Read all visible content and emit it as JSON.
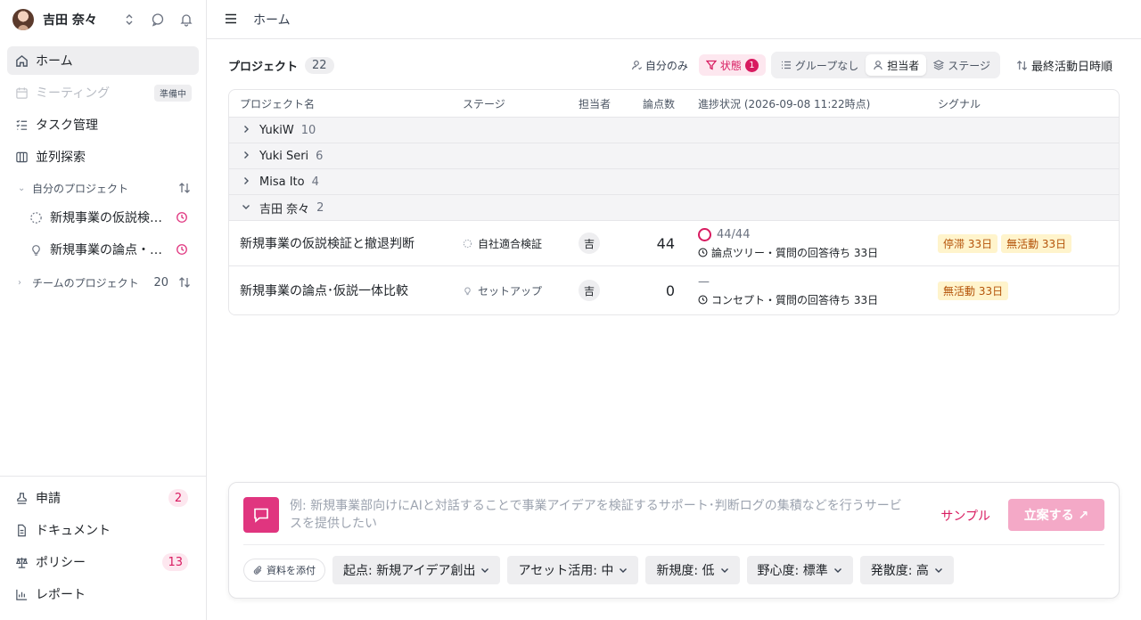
{
  "user": {
    "name": "吉田 奈々"
  },
  "sidebar": {
    "nav": [
      {
        "label": "ホーム"
      },
      {
        "label": "ミーティング",
        "badge": "準備中"
      },
      {
        "label": "タスク管理"
      },
      {
        "label": "並列探索"
      }
    ],
    "my_projects": {
      "label": "自分のプロジェクト",
      "items": [
        {
          "label": "新規事業の仮説検証と撤退判断"
        },
        {
          "label": "新規事業の論点・仮説一体比較"
        }
      ]
    },
    "team_projects": {
      "label": "チームのプロジェクト",
      "count": "20"
    },
    "bottom": [
      {
        "label": "申請",
        "count": "2"
      },
      {
        "label": "ドキュメント"
      },
      {
        "label": "ポリシー",
        "count": "13"
      },
      {
        "label": "レポート"
      }
    ]
  },
  "topbar": {
    "breadcrumb": "ホーム"
  },
  "toolbar": {
    "title": "プロジェクト",
    "count": "22",
    "mine_only": "自分のみ",
    "status": "状態",
    "status_count": "1",
    "group_none": "グループなし",
    "group_owner": "担当者",
    "group_stage": "ステージ",
    "sort": "最終活動日時順"
  },
  "table": {
    "headers": {
      "name": "プロジェクト名",
      "stage": "ステージ",
      "owner": "担当者",
      "points": "論点数",
      "progress": "進捗状況 (2026-09-08 11:22時点)",
      "signal": "シグナル"
    },
    "groups": [
      {
        "name": "YukiW",
        "count": "10"
      },
      {
        "name": "Yuki Seri",
        "count": "6"
      },
      {
        "name": "Misa Ito",
        "count": "4"
      },
      {
        "name": "吉田 奈々",
        "count": "2"
      }
    ],
    "rows": [
      {
        "name": "新規事業の仮説検証と撤退判断",
        "stage": "自社適合検証",
        "owner": "吉",
        "points": "44",
        "progress_value": "44/44",
        "progress_status": "論点ツリー・質問の回答待ち 33日",
        "signals": [
          "停滞 33日",
          "無活動 33日"
        ]
      },
      {
        "name": "新規事業の論点･仮説一体比較",
        "stage": "セットアップ",
        "owner": "吉",
        "points": "0",
        "progress_value": "—",
        "progress_status": "コンセプト・質問の回答待ち 33日",
        "signals": [
          "無活動 33日"
        ]
      }
    ]
  },
  "composer": {
    "placeholder": "例: 新規事業部向けにAIと対話することで事業アイデアを検証するサポート･判断ログの集積などを行うサービスを提供したい",
    "sample": "サンプル",
    "submit": "立案する ↗",
    "attach": "資料を添付",
    "options": [
      "起点: 新規アイデア創出",
      "アセット活用: 中",
      "新規度: 低",
      "野心度: 標準",
      "発散度: 高"
    ]
  },
  "colors": {
    "accent": "#e0357f",
    "signal_bg": "#fff4cc",
    "signal_text": "#b45309"
  }
}
